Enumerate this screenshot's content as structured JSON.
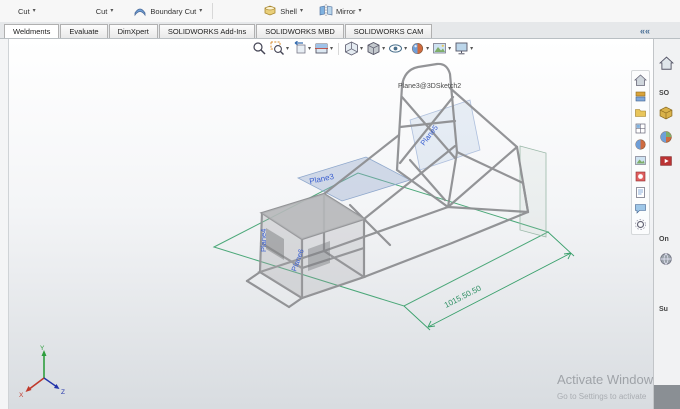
{
  "ribbon": {
    "buttons": [
      {
        "label": "Cut"
      },
      {
        "label": "Cut"
      },
      {
        "label": "Boundary Cut"
      },
      {
        "label": "Shell"
      },
      {
        "label": "Mirror"
      }
    ],
    "icon_names": [
      "boundary-cut-icon",
      "shell-icon",
      "mirror-icon"
    ]
  },
  "tabs": {
    "items": [
      "Weldments",
      "Evaluate",
      "DimXpert",
      "SOLIDWORKS Add-Ins",
      "SOLIDWORKS MBD",
      "SOLIDWORKS CAM"
    ],
    "collapse": "««"
  },
  "hud": {
    "icon_names": [
      "zoom-to-fit-icon",
      "zoom-to-area-icon",
      "previous-view-icon",
      "section-view-icon",
      "view-orientation-icon",
      "display-style-icon",
      "hide-show-items-icon",
      "edit-appearance-icon",
      "apply-scene-icon",
      "view-settings-icon"
    ]
  },
  "viewport": {
    "feature_callout": "Plane3@3DSketch2",
    "plane_labels": {
      "mid": "Plane3",
      "hoop": "Plane5",
      "front_vertical": "Plane4",
      "front_lower": "Plane6"
    },
    "dimension": "1015.50.50",
    "triad": {
      "x": "X",
      "y": "Y",
      "z": "Z"
    },
    "colors": {
      "plane_label": "#3a5fd0",
      "dimension": "#2e8f63",
      "sketch_green": "#3aa06c"
    }
  },
  "side_strip": {
    "icon_names": [
      "home-icon",
      "design-library-icon",
      "file-explorer-icon",
      "view-palette-icon",
      "appearances-icon",
      "scenes-icon",
      "decals-icon",
      "custom-properties-icon",
      "forum-icon",
      "settings-icon"
    ]
  },
  "task_pane": {
    "labels": {
      "s1": "SO",
      "s2": "On",
      "s3": "Su"
    },
    "icon_names": [
      "home-icon",
      "parts-cube-icon",
      "appearance-ball-icon",
      "tutorials-icon",
      "community-icon"
    ]
  },
  "watermark": {
    "line1": "Activate Windows",
    "line2": "Go to Settings to activate"
  }
}
